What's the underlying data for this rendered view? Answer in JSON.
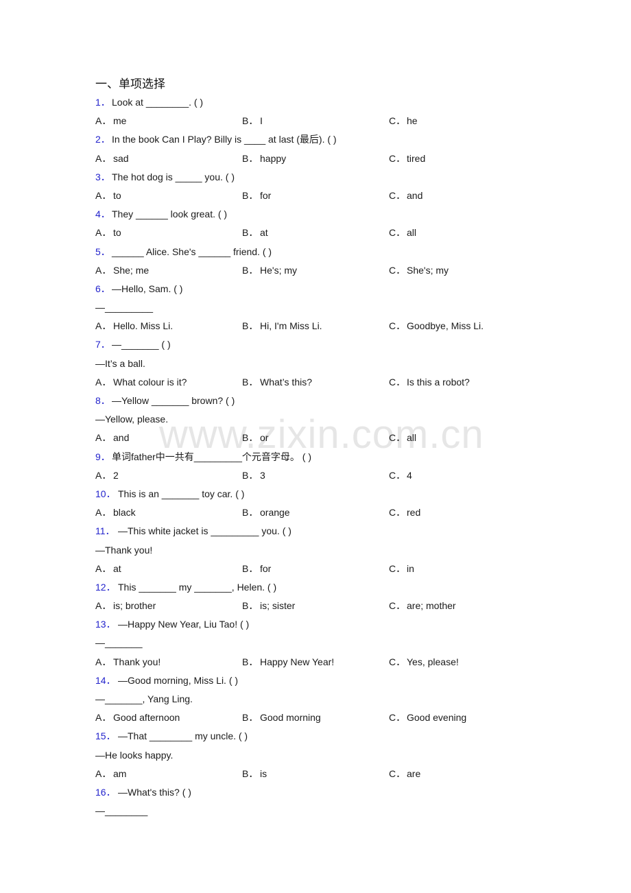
{
  "section_title": "一、单项选择",
  "watermark": "www.zixin.com.cn",
  "colors": {
    "question_number": "#2222cc",
    "text": "#1a1a1a",
    "watermark": "#bebebe"
  },
  "questions": [
    {
      "num": "1．",
      "stem": "Look at ________. (        )",
      "reply": null,
      "options": [
        "A．",
        "me",
        "B．",
        "I",
        "C．",
        "he"
      ]
    },
    {
      "num": "2．",
      "stem": "In the book Can I Play? Billy is ____ at last (最后). (    )",
      "reply": null,
      "options": [
        "A．",
        "sad",
        "B．",
        "happy",
        "C．",
        "tired"
      ]
    },
    {
      "num": "3．",
      "stem": "The hot dog is _____ you. (    )",
      "reply": null,
      "options": [
        "A．",
        "to",
        "B．",
        "for",
        "C．",
        "and"
      ]
    },
    {
      "num": "4．",
      "stem": "They ______ look great. (    )",
      "reply": null,
      "options": [
        "A．",
        "to",
        "B．",
        "at",
        "C．",
        "all"
      ]
    },
    {
      "num": "5．",
      "stem": "______ Alice. She's ______ friend. (    )",
      "reply": null,
      "options": [
        "A．",
        "She; me",
        "B．",
        "He's; my",
        "C．",
        "She's; my"
      ]
    },
    {
      "num": "6．",
      "stem": "—Hello, Sam. (   )",
      "reply": "—_________",
      "options": [
        "A．",
        "Hello. Miss Li.",
        "B．",
        "Hi, I'm Miss Li.",
        "C．",
        "Goodbye, Miss Li."
      ]
    },
    {
      "num": "7．",
      "stem": "—_______ (    )",
      "reply": "—It’s a ball.",
      "options": [
        "A．",
        "What colour is it?",
        "B．",
        "What’s this?",
        "C．",
        "Is this a robot?"
      ]
    },
    {
      "num": "8．",
      "stem": "—Yellow _______ brown? (   )",
      "reply": "—Yellow, please.",
      "options": [
        "A．",
        "and",
        "B．",
        "or",
        "C．",
        "all"
      ]
    },
    {
      "num": "9．",
      "stem": "单词father中一共有_________个元音字母。 (   )",
      "reply": null,
      "options": [
        "A．",
        "2",
        "B．",
        "3",
        "C．",
        "4"
      ]
    },
    {
      "num": "10．",
      "stem": "This is an _______ toy car. (   )",
      "reply": null,
      "options": [
        "A．",
        "black",
        "B．",
        "orange",
        "C．",
        "red"
      ]
    },
    {
      "num": "11．",
      "stem": "—This white jacket is _________ you. (  )",
      "reply": "—Thank you!",
      "options": [
        "A．",
        "at",
        "B．",
        "for",
        "C．",
        "in"
      ]
    },
    {
      "num": "12．",
      "stem": "This _______ my _______, Helen. (   )",
      "reply": null,
      "options": [
        "A．",
        "is; brother",
        "B．",
        "is; sister",
        "C．",
        "are; mother"
      ]
    },
    {
      "num": "13．",
      "stem": "—Happy New Year, Liu Tao! (   )",
      "reply": "—_______",
      "options": [
        "A．",
        "Thank you!",
        "B．",
        "Happy New Year!",
        "C．",
        "Yes, please!"
      ]
    },
    {
      "num": "14．",
      "stem": "—Good morning, Miss Li. (   )",
      "reply": "—_______, Yang Ling.",
      "options": [
        "A．",
        "Good afternoon",
        "B．",
        "Good morning",
        "C．",
        "Good evening"
      ]
    },
    {
      "num": "15．",
      "stem": "—That ________ my uncle. (     )",
      "reply": "—He looks happy.",
      "options": [
        "A．",
        "am",
        "B．",
        "is",
        "C．",
        "are"
      ]
    },
    {
      "num": "16．",
      "stem": "—What's this? (     )",
      "reply": "—________",
      "options": null
    }
  ]
}
